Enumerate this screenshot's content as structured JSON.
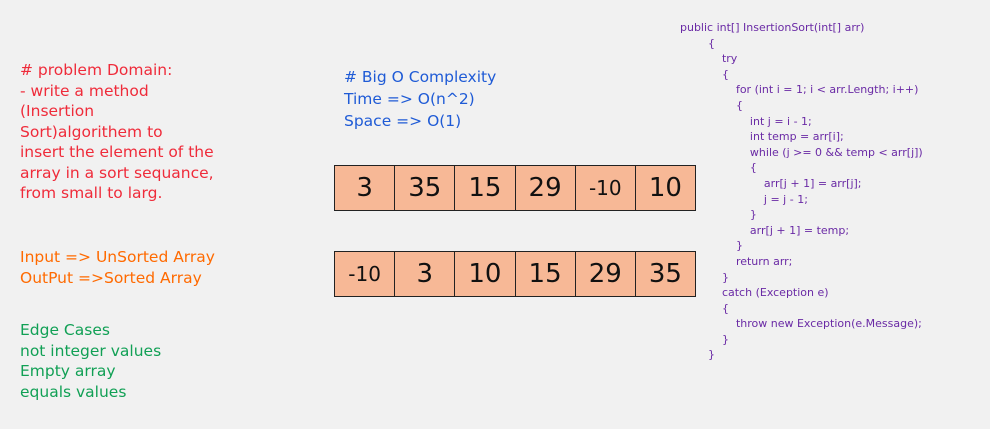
{
  "problem": {
    "lines": [
      "# problem Domain:",
      "- write a method",
      "(Insertion",
      "Sort)algorithem to",
      "insert the element of the",
      "array in a sort sequance,",
      "from small to larg."
    ]
  },
  "io": {
    "lines": [
      "Input => UnSorted Array",
      "OutPut =>Sorted Array"
    ]
  },
  "edge_cases": {
    "lines": [
      "Edge Cases",
      "not integer values",
      "Empty array",
      "equals values"
    ]
  },
  "complexity": {
    "lines": [
      "# Big O Complexity",
      "Time => O(n^2)",
      "Space => O(1)"
    ]
  },
  "arrays": {
    "unsorted": [
      "3",
      "35",
      "15",
      "29",
      "-10",
      "10"
    ],
    "sorted": [
      "-10",
      "3",
      "10",
      "15",
      "29",
      "35"
    ]
  },
  "code": {
    "lines": [
      "public int[] InsertionSort(int[] arr)",
      "        {",
      "            try",
      "            {",
      "                for (int i = 1; i < arr.Length; i++)",
      "                {",
      "                    int j = i - 1;",
      "                    int temp = arr[i];",
      "                    while (j >= 0 && temp < arr[j])",
      "                    {",
      "                        arr[j + 1] = arr[j];",
      "                        j = j - 1;",
      "                    }",
      "                    arr[j + 1] = temp;",
      "                }",
      "                return arr;",
      "            }",
      "            catch (Exception e)",
      "            {",
      "                throw new Exception(e.Message);",
      "            }",
      "        }"
    ]
  },
  "colors": {
    "problem": "#ef2b3a",
    "io": "#ff6a00",
    "edge": "#11a055",
    "complexity": "#1f5bd6",
    "code": "#6a2aa5",
    "cell_fill": "#f7b896"
  }
}
